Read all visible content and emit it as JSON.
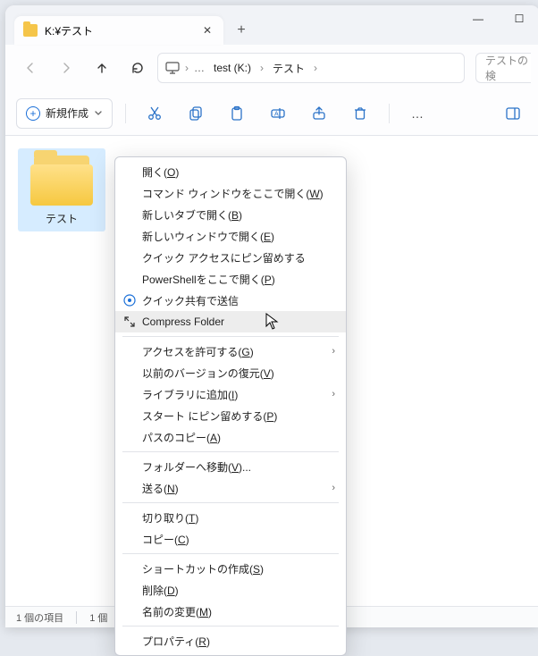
{
  "titlebar": {
    "tab_label": "K:¥テスト",
    "close_glyph": "✕",
    "newtab_glyph": "+",
    "min_glyph": "—",
    "max_glyph": "☐"
  },
  "nav": {
    "back": "←",
    "fwd": "→",
    "up": "↑",
    "refresh": "⟳"
  },
  "address": {
    "pc_icon": "🖥",
    "seg_drive": "test (K:)",
    "seg_folder": "テスト",
    "ellipsis": "…",
    "chevron": "›"
  },
  "search": {
    "placeholder": "テストの検"
  },
  "toolbar": {
    "new_label": "新規作成",
    "cut": "scissors-icon",
    "copy": "copy-icon",
    "paste": "clipboard-icon",
    "rename": "rename-icon",
    "share": "share-icon",
    "delete": "trash-icon",
    "more": "…"
  },
  "content": {
    "folder_name": "テスト"
  },
  "status": {
    "count": "1 個の項目",
    "selected": "1 個"
  },
  "ctx": {
    "open": "開く(O)",
    "cmd_here": "コマンド ウィンドウをここで開く(W)",
    "new_tab": "新しいタブで開く(B)",
    "new_win": "新しいウィンドウで開く(E)",
    "pin_quick": "クイック アクセスにピン留めする",
    "ps_here": "PowerShellをここで開く(P)",
    "quick_share": "クイック共有で送信",
    "compress": "Compress Folder",
    "give_access": "アクセスを許可する(G)",
    "restore_prev": "以前のバージョンの復元(V)",
    "add_library": "ライブラリに追加(I)",
    "pin_start": "スタート にピン留めする(P)",
    "copy_path": "パスのコピー(A)",
    "move_to": "フォルダーへ移動(V)...",
    "send_to": "送る(N)",
    "cut_item": "切り取り(T)",
    "copy_item": "コピー(C)",
    "shortcut": "ショートカットの作成(S)",
    "delete_item": "削除(D)",
    "rename_item": "名前の変更(M)",
    "properties": "プロパティ(R)"
  }
}
